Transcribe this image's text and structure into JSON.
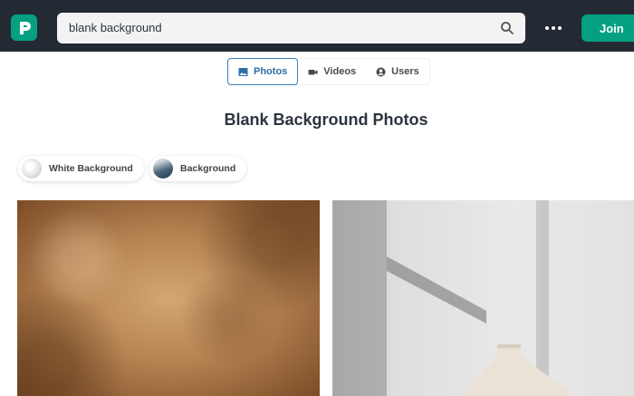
{
  "header": {
    "search_value": "blank background",
    "join_label": "Join",
    "colors": {
      "bar": "#232a34",
      "brand": "#05a081"
    }
  },
  "tabs": [
    {
      "label": "Photos",
      "icon": "image-icon",
      "active": true
    },
    {
      "label": "Videos",
      "icon": "video-icon",
      "active": false
    },
    {
      "label": "Users",
      "icon": "user-icon",
      "active": false
    }
  ],
  "page_title": "Blank Background Photos",
  "related": [
    {
      "label": "White Background"
    },
    {
      "label": "Background"
    }
  ]
}
